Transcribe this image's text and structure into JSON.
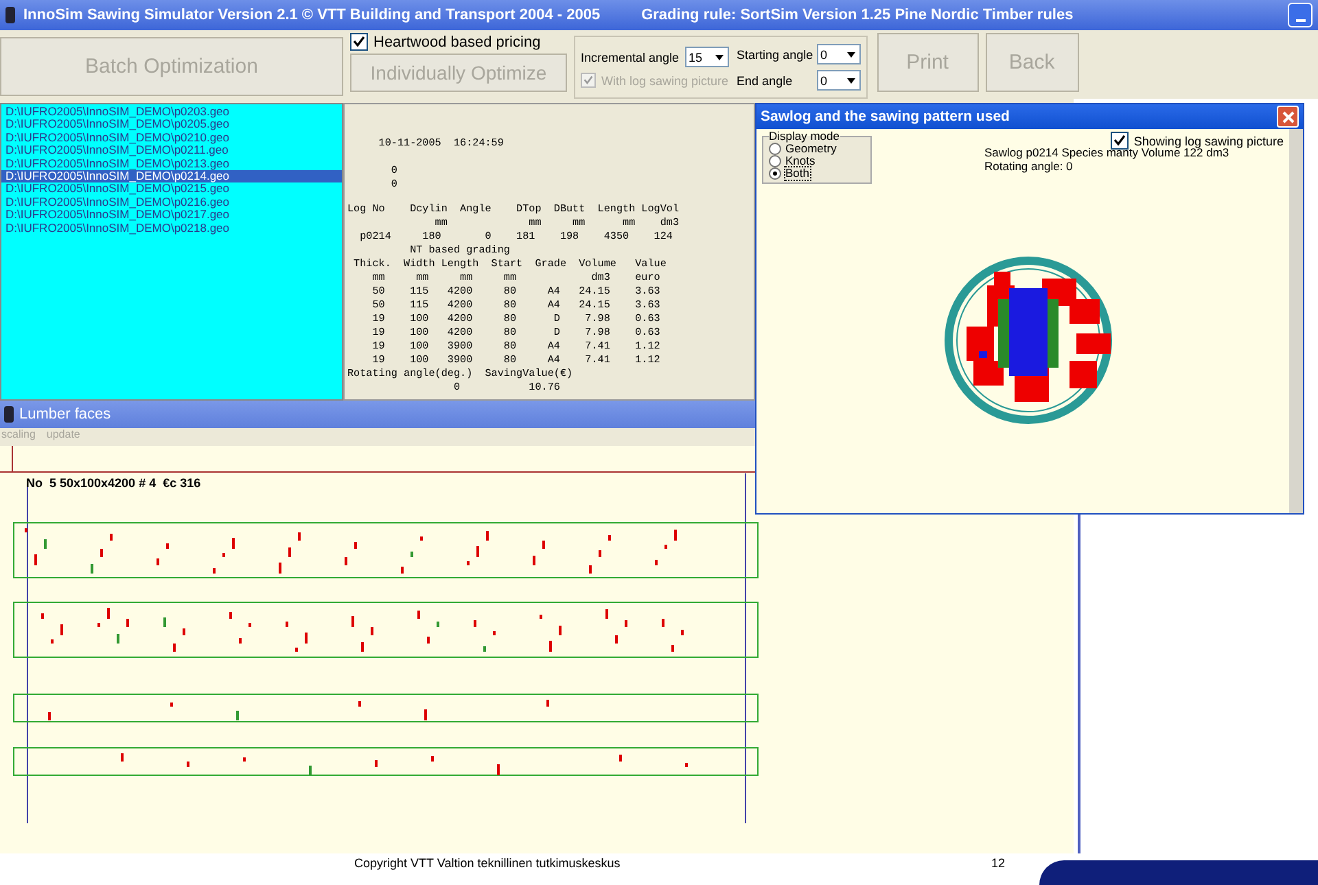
{
  "window": {
    "title": "InnoSim Sawing Simulator Version 2.1  © VTT Building and Transport 2004 - 2005",
    "grading_rule": "Grading rule: SortSim Version 1.25  Pine  Nordic Timber rules"
  },
  "toolbar": {
    "batch_button": {
      "label": "Batch Optimization",
      "disabled": true
    },
    "heartwood": {
      "label": "Heartwood based pricing",
      "checked": true
    },
    "individual_button": {
      "label": "Individually Optimize",
      "disabled": true
    },
    "incremental_angle": {
      "label": "Incremental angle",
      "value": "15"
    },
    "log_picture": {
      "label": "With log sawing picture",
      "checked": true,
      "disabled": true
    },
    "starting_angle": {
      "label": "Starting angle",
      "value": "0"
    },
    "end_angle": {
      "label": "End angle",
      "value": "0"
    },
    "print_button": {
      "label": "Print",
      "disabled": true
    },
    "back_button": {
      "label": "Back",
      "disabled": true
    }
  },
  "files": [
    {
      "path": "D:\\IUFRO2005\\InnoSIM_DEMO\\p0203.geo",
      "selected": false
    },
    {
      "path": "D:\\IUFRO2005\\InnoSIM_DEMO\\p0205.geo",
      "selected": false
    },
    {
      "path": "D:\\IUFRO2005\\InnoSIM_DEMO\\p0210.geo",
      "selected": false
    },
    {
      "path": "D:\\IUFRO2005\\InnoSIM_DEMO\\p0211.geo",
      "selected": false
    },
    {
      "path": "D:\\IUFRO2005\\InnoSIM_DEMO\\p0213.geo",
      "selected": false
    },
    {
      "path": "D:\\IUFRO2005\\InnoSIM_DEMO\\p0214.geo",
      "selected": true
    },
    {
      "path": "D:\\IUFRO2005\\InnoSIM_DEMO\\p0215.geo",
      "selected": false
    },
    {
      "path": "D:\\IUFRO2005\\InnoSIM_DEMO\\p0216.geo",
      "selected": false
    },
    {
      "path": "D:\\IUFRO2005\\InnoSIM_DEMO\\p0217.geo",
      "selected": false
    },
    {
      "path": "D:\\IUFRO2005\\InnoSIM_DEMO\\p0218.geo",
      "selected": false
    }
  ],
  "report": {
    "timestamp": "     10-11-2005  16:24:59",
    "counters": [
      "       0",
      "       0"
    ],
    "lines": [
      "Log No    Dcylin  Angle    DTop  DButt  Length LogVol",
      "              mm             mm     mm      mm    dm3",
      "  p0214     180       0    181    198    4350    124",
      "          NT based grading",
      " Thick.  Width Length  Start  Grade  Volume   Value",
      "    mm     mm     mm     mm            dm3    euro",
      "    50    115   4200     80     A4   24.15    3.63",
      "    50    115   4200     80     A4   24.15    3.63",
      "    19    100   4200     80      D    7.98    0.63",
      "    19    100   4200     80      D    7.98    0.63",
      "    19    100   3900     80     A4    7.41    1.12",
      "    19    100   3900     80     A4    7.41    1.12",
      "Rotating angle(deg.)  SavingValue(€)",
      "                 0           10.76"
    ]
  },
  "sawlog_window": {
    "title": "Sawlog and the sawing pattern used",
    "display_mode": {
      "label": "Display mode",
      "options": [
        {
          "label": "Geometry",
          "selected": false
        },
        {
          "label": "Knots",
          "selected": false
        },
        {
          "label": "Both",
          "selected": true
        }
      ]
    },
    "showing_picture": {
      "label": "Showing log sawing picture",
      "checked": true
    },
    "info": [
      "Sawlog  p0214  Species  manty  Volume  122 dm3",
      "Rotating angle: 0"
    ]
  },
  "lumber_faces": {
    "title": "Lumber faces",
    "menu": [
      {
        "label": "scaling",
        "disabled": true
      },
      {
        "label": "update",
        "disabled": true
      }
    ],
    "board_label": "No  5 50x100x4200 # 4  €c 316"
  },
  "footer": {
    "copyright": "Copyright  VTT Valtion teknillinen tutkimuskeskus",
    "page": "12"
  }
}
